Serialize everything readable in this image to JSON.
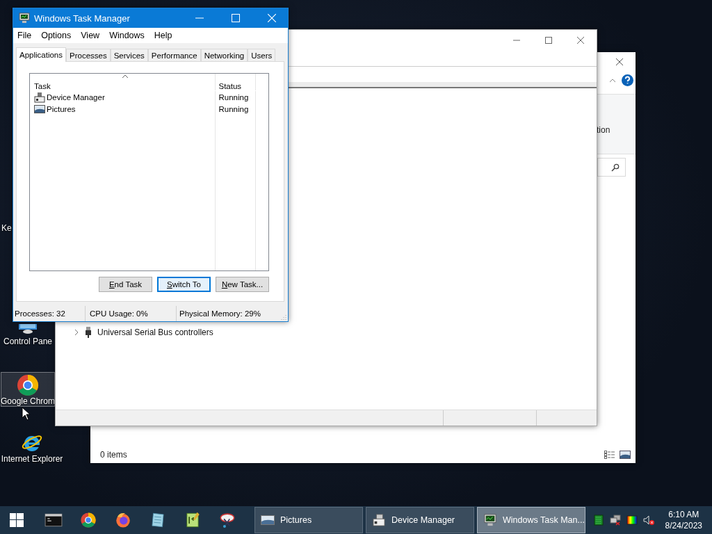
{
  "desktop_icons": [
    {
      "label": "Ke",
      "kind": "hidden",
      "selected": false
    },
    {
      "label": "Control Pane",
      "kind": "control-panel",
      "selected": false
    },
    {
      "label": "Google Chrom",
      "kind": "chrome",
      "selected": true
    },
    {
      "label": "Internet Explorer",
      "kind": "ie",
      "selected": false
    }
  ],
  "pictures_window": {
    "ribbon_text": "tion",
    "status": "0 items"
  },
  "device_manager": {
    "tree_items": [
      {
        "label": "Universal Serial Bus controllers",
        "expanded": false
      }
    ]
  },
  "task_manager": {
    "title": "Windows Task Manager",
    "menu": [
      "File",
      "Options",
      "View",
      "Windows",
      "Help"
    ],
    "tabs": [
      {
        "label": "Applications",
        "selected": true
      },
      {
        "label": "Processes",
        "selected": false
      },
      {
        "label": "Services",
        "selected": false
      },
      {
        "label": "Performance",
        "selected": false
      },
      {
        "label": "Networking",
        "selected": false
      },
      {
        "label": "Users",
        "selected": false
      }
    ],
    "columns": [
      "Task",
      "Status"
    ],
    "tasks": [
      {
        "name": "Device Manager",
        "status": "Running",
        "kind": "device"
      },
      {
        "name": "Pictures",
        "status": "Running",
        "kind": "pictures"
      }
    ],
    "buttons": [
      {
        "label": "End Task",
        "default": false
      },
      {
        "label": "Switch To",
        "default": true
      },
      {
        "label": "New Task...",
        "default": false
      }
    ],
    "status_bar": [
      "Processes: 32",
      "CPU Usage: 0%",
      "Physical Memory: 29%"
    ]
  },
  "taskbar": {
    "windows": [
      {
        "label": "Pictures",
        "kind": "pictures",
        "active": false
      },
      {
        "label": "Device Manager",
        "kind": "device",
        "active": false
      },
      {
        "label": "Windows Task Man...",
        "kind": "taskmgr",
        "active": true
      }
    ],
    "clock": {
      "time": "6:10 AM",
      "date": "8/24/2023"
    }
  }
}
